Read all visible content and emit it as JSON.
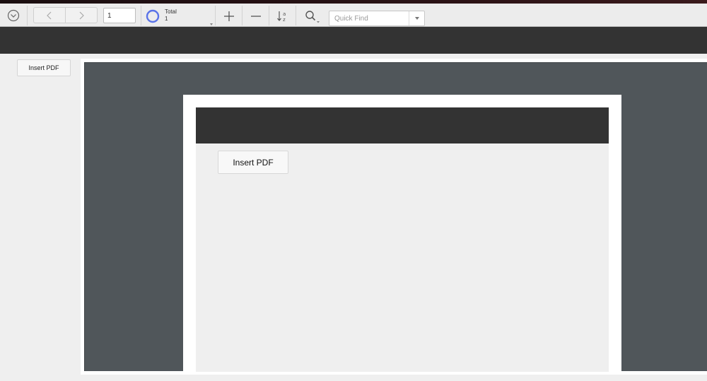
{
  "toolbar": {
    "page_number": "1",
    "progress_title": "Total",
    "progress_count": "1",
    "quick_find_placeholder": "Quick Find",
    "icons": {
      "menu": "chevron-down-circle-icon",
      "previous": "chevron-left-icon",
      "next": "chevron-right-icon",
      "progress": "progress-ring-icon",
      "zoom_in": "plus-icon",
      "zoom_out": "minus-icon",
      "sort": "sort-az-icon",
      "search": "magnifier-icon"
    },
    "accent_color": "#5a73e8"
  },
  "sidebar": {
    "insert_label": "Insert PDF"
  },
  "preview": {
    "insert_label": "Insert PDF"
  }
}
